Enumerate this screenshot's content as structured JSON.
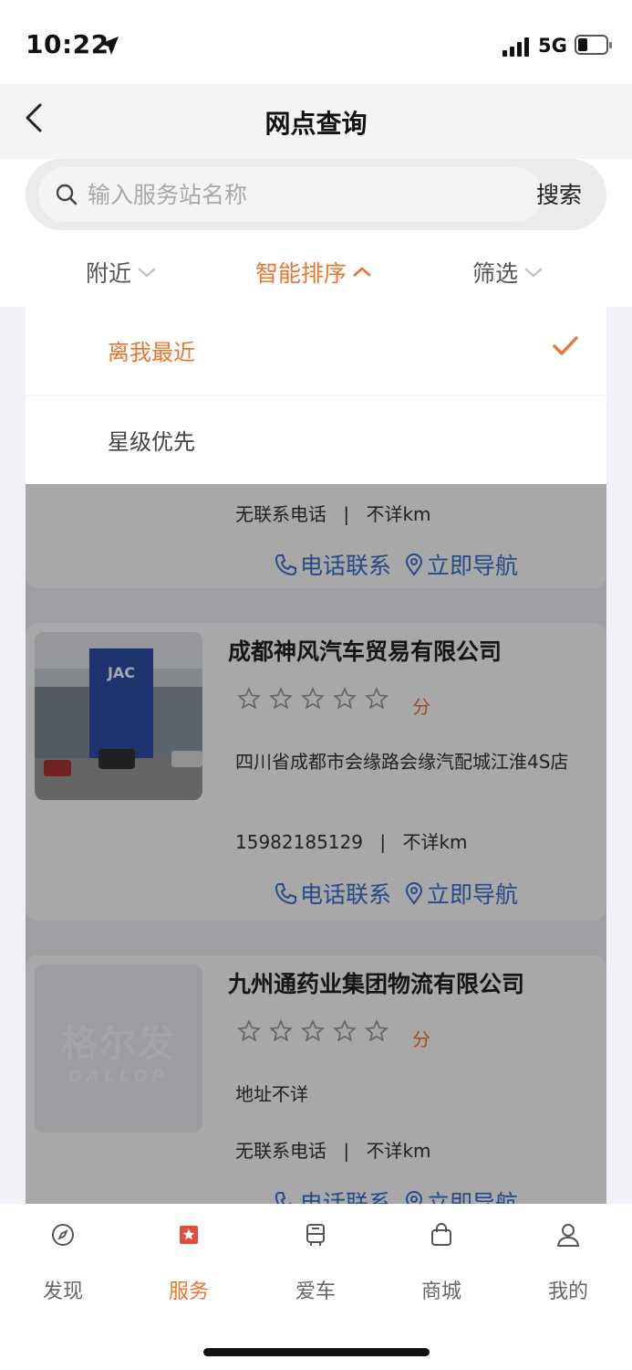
{
  "status_bar": {
    "time": "10:22",
    "network": "5G"
  },
  "nav": {
    "title": "网点查询"
  },
  "search": {
    "placeholder": "输入服务站名称",
    "button_label": "搜索"
  },
  "filters": [
    {
      "label": "附近",
      "state": "collapsed"
    },
    {
      "label": "智能排序",
      "state": "expanded"
    },
    {
      "label": "筛选",
      "state": "collapsed"
    }
  ],
  "sort_dropdown": {
    "options": [
      {
        "label": "离我最近",
        "selected": true
      },
      {
        "label": "星级优先",
        "selected": false
      }
    ]
  },
  "cards": [
    {
      "name": "",
      "phone": "无联系电话",
      "distance": "不详km",
      "call_label": "电话联系",
      "nav_label": "立即导航"
    },
    {
      "name": "成都神风汽车贸易有限公司",
      "score_unit": "分",
      "rating": 0,
      "address": "四川省成都市会缘路会缘汽配城江淮4S店",
      "phone": "15982185129",
      "distance": "不详km",
      "call_label": "电话联系",
      "nav_label": "立即导航",
      "image_sign_text": "JAC"
    },
    {
      "name": "九州通药业集团物流有限公司",
      "score_unit": "分",
      "rating": 0,
      "address": "地址不详",
      "phone": "无联系电话",
      "distance": "不详km",
      "call_label": "电话联系",
      "nav_label": "立即导航",
      "image_logo_text": "格尔发",
      "image_logo_sub": "GALLOP"
    }
  ],
  "tabs": [
    {
      "label": "发现",
      "icon": "compass-icon",
      "active": false
    },
    {
      "label": "服务",
      "icon": "service-star-icon",
      "active": true
    },
    {
      "label": "爱车",
      "icon": "bus-icon",
      "active": false
    },
    {
      "label": "商城",
      "icon": "shopping-bag-icon",
      "active": false
    },
    {
      "label": "我的",
      "icon": "user-icon",
      "active": false
    }
  ],
  "colors": {
    "accent": "#e8762f",
    "link": "#3b6fd1"
  }
}
